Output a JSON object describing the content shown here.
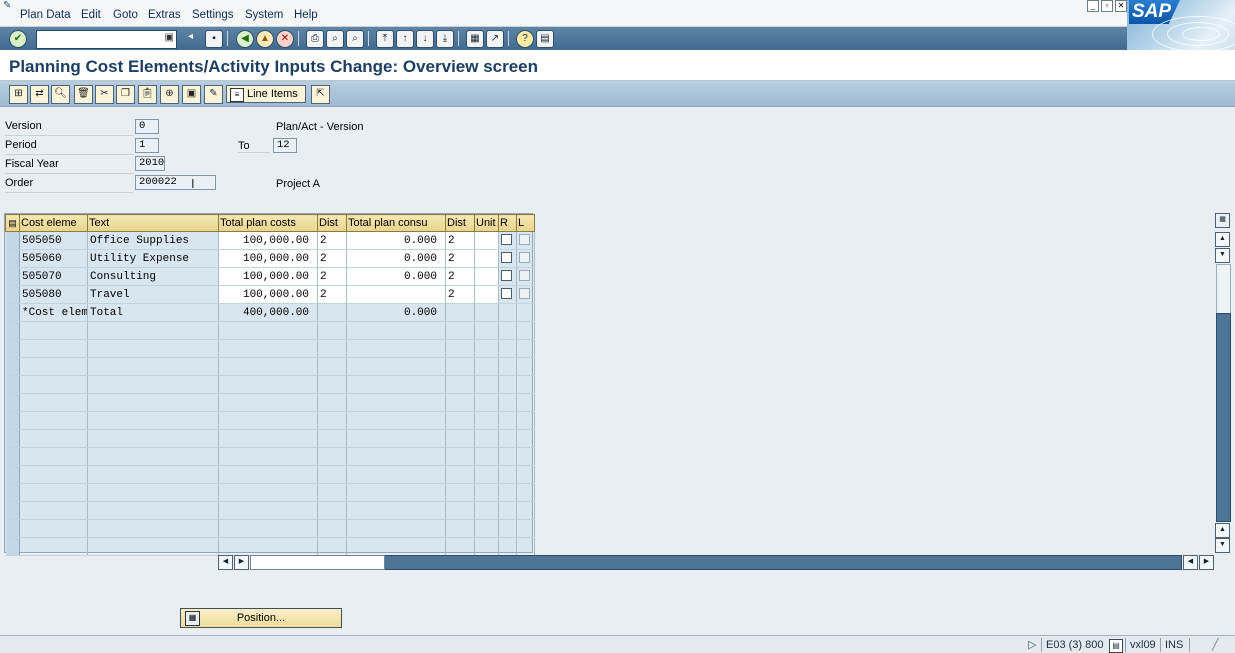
{
  "menu": [
    "Plan Data",
    "Edit",
    "Goto",
    "Extras",
    "Settings",
    "System",
    "Help"
  ],
  "logo_text": "SAP",
  "command_field": {
    "value": ""
  },
  "title": "Planning Cost Elements/Activity Inputs Change: Overview screen",
  "app_toolbar": {
    "line_items_label": "Line Items"
  },
  "header": {
    "version_label": "Version",
    "version_value": "0",
    "version_desc": "Plan/Act - Version",
    "period_label": "Period",
    "period_from": "1",
    "to_label": "To",
    "period_to": "12",
    "fiscal_year_label": "Fiscal Year",
    "fiscal_year_value": "2010",
    "order_label": "Order",
    "order_value": "200022",
    "order_desc": "Project A"
  },
  "table": {
    "columns": [
      "Cost eleme",
      "Text",
      "Total plan costs",
      "Dist",
      "Total plan consu",
      "Dist",
      "Unit",
      "R",
      "L"
    ],
    "rows": [
      {
        "cost_element": "505050",
        "text": "Office Supplies",
        "total_plan_costs": "100,000.00",
        "dist": "2",
        "total_plan_consu": "0.000",
        "dist2": "2"
      },
      {
        "cost_element": "505060",
        "text": "Utility Expense",
        "total_plan_costs": "100,000.00",
        "dist": "2",
        "total_plan_consu": "0.000",
        "dist2": "2"
      },
      {
        "cost_element": "505070",
        "text": "Consulting",
        "total_plan_costs": "100,000.00",
        "dist": "2",
        "total_plan_consu": "0.000",
        "dist2": "2"
      },
      {
        "cost_element": "505080",
        "text": "Travel",
        "total_plan_costs": "100,000.00",
        "dist": "2",
        "total_plan_consu": "",
        "dist2": "2"
      }
    ],
    "total_row": {
      "cost_element": "*Cost elem",
      "text": "Total",
      "total_plan_costs": "400,000.00",
      "total_plan_consu": "0.000"
    }
  },
  "position_button": "Position...",
  "status": {
    "system": "E03 (3) 800",
    "server": "vxl09",
    "mode": "INS"
  },
  "colors": {
    "header_yellow": "#e9d48b",
    "toolbar_blue": "#3f6a90",
    "title_blue": "#1c3f63"
  }
}
